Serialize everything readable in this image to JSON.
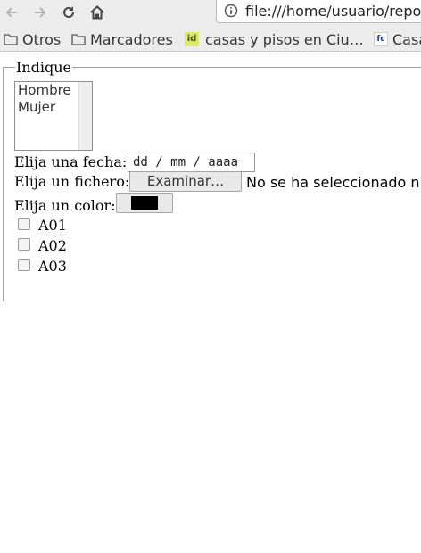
{
  "browser": {
    "url": "file:///home/usuario/repo",
    "bookmarks": [
      {
        "label": "Otros",
        "icon": "folder-icon"
      },
      {
        "label": "Marcadores",
        "icon": "folder-icon"
      },
      {
        "label": "casas y pisos en Ciu…",
        "icon": "id-favicon"
      },
      {
        "label": "Casa",
        "icon": "fc-favicon"
      }
    ],
    "favicon_id_text": "id",
    "favicon_fc_text": "fc"
  },
  "form": {
    "legend": "Indique",
    "gender_options": [
      "Hombre",
      "Mujer"
    ],
    "date_label": "Elija una fecha:",
    "date_placeholder": "dd / mm / aaaa",
    "file_label": "Elija un fichero:",
    "file_button": "Examinar…",
    "file_status": "No se ha seleccionado ni",
    "color_label": "Elija un color:",
    "color_value": "#000000",
    "checkboxes": [
      "A01",
      "A02",
      "A03"
    ]
  }
}
